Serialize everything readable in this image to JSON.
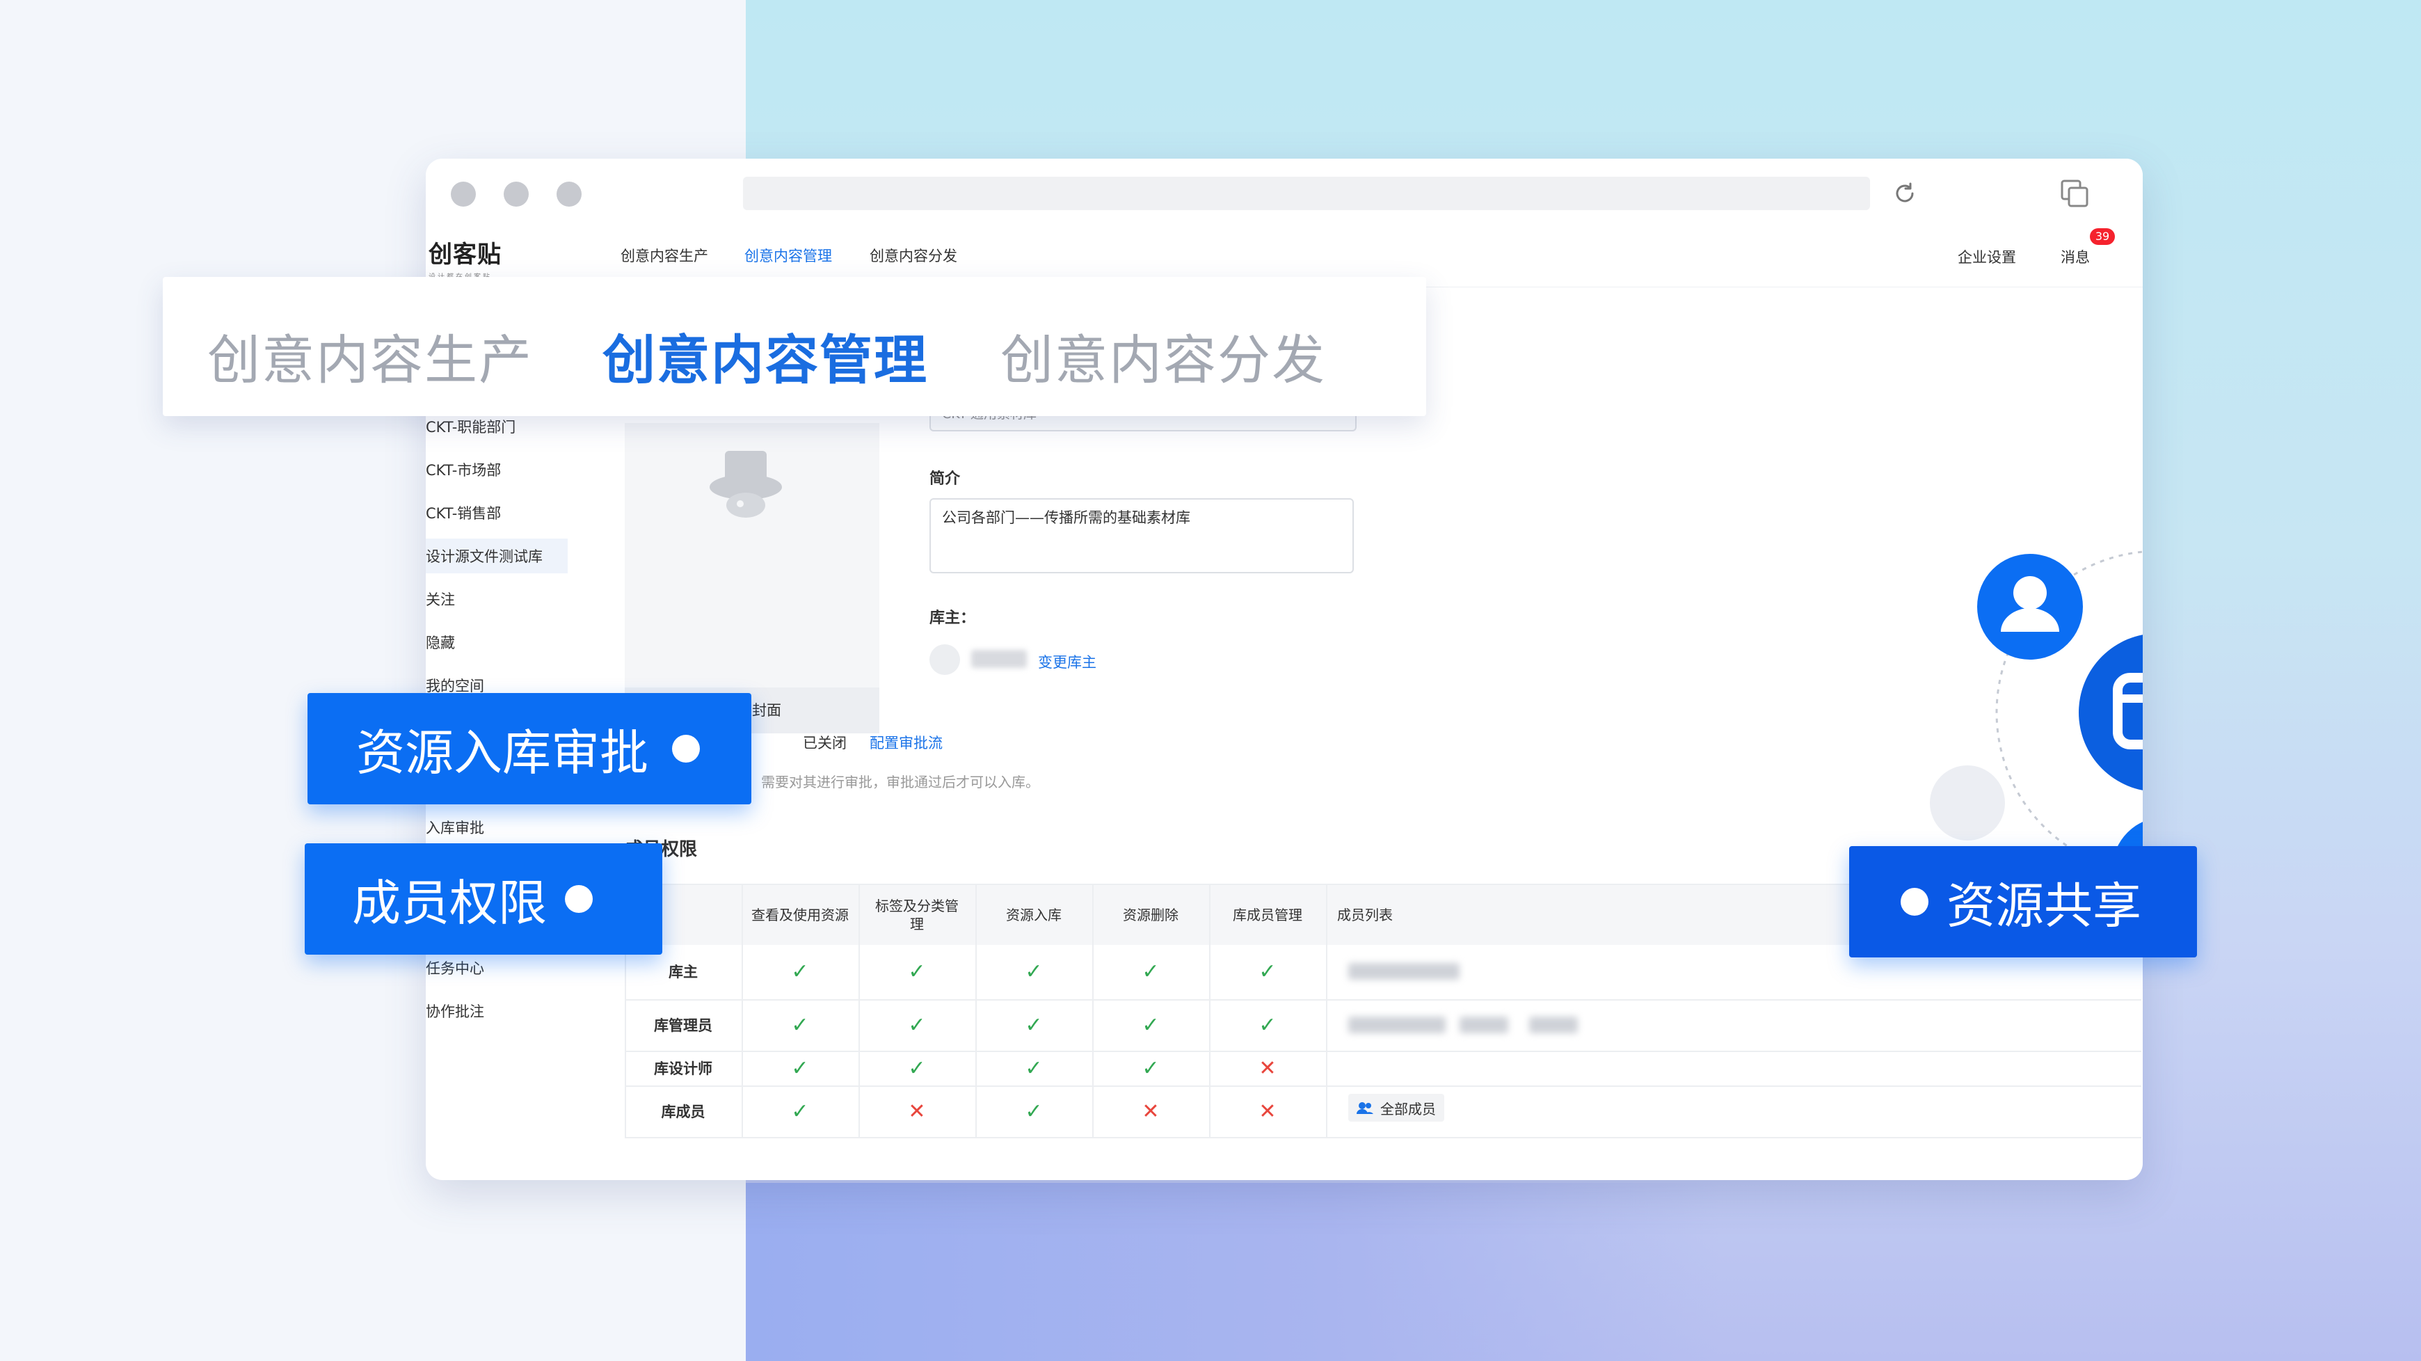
{
  "app": {
    "logo_text": "创客贴",
    "logo_sub": "设计都在创客贴"
  },
  "nav": {
    "links": [
      "创意内容生产",
      "创意内容管理",
      "创意内容分发"
    ],
    "active_index": 1,
    "settings_label": "企业设置",
    "messages_label": "消息",
    "messages_badge": "39"
  },
  "sidebar": {
    "items": [
      "CKT-职能部门",
      "CKT-市场部",
      "CKT-销售部",
      "设计源文件测试库",
      "关注",
      "隐藏",
      "我的空间",
      "入库审批",
      "任务中心",
      "协作批注"
    ],
    "selected_index": 3
  },
  "library": {
    "cover_button_label": "修改封面",
    "name_value": "CKT-通用素材库",
    "intro_label": "简介",
    "intro_value": "公司各部门——传播所需的基础素材库",
    "owner_label": "库主：",
    "change_owner_label": "变更库主"
  },
  "approval": {
    "toggle_state_label": "已关闭",
    "config_link": "配置审批流",
    "hint": "需要对其进行审批，审批通过后才可以入库。"
  },
  "permissions": {
    "title": "成员权限",
    "columns": [
      "",
      "查看及使用资源",
      "标签及分类管理",
      "资源入库",
      "资源删除",
      "库成员管理",
      "成员列表"
    ],
    "rows": [
      {
        "role": "库主",
        "perms": [
          true,
          true,
          true,
          true,
          true
        ],
        "members_blurred": true
      },
      {
        "role": "库管理员",
        "perms": [
          true,
          true,
          true,
          true,
          true
        ],
        "members_blurred": true
      },
      {
        "role": "库设计师",
        "perms": [
          true,
          true,
          true,
          true,
          false
        ],
        "members_blurred": false
      },
      {
        "role": "库成员",
        "perms": [
          true,
          false,
          true,
          false,
          false
        ],
        "member_chip": "全部成员"
      }
    ]
  },
  "overlay_tabs": [
    "创意内容生产",
    "创意内容管理",
    "创意内容分发"
  ],
  "overlay_active_index": 1,
  "feature_labels": {
    "approval": "资源入库审批",
    "member_perms": "成员权限",
    "sharing": "资源共享"
  },
  "colors": {
    "brand_blue": "#0b6ef3",
    "check_green": "#32a852",
    "cross_red": "#e8453c"
  }
}
